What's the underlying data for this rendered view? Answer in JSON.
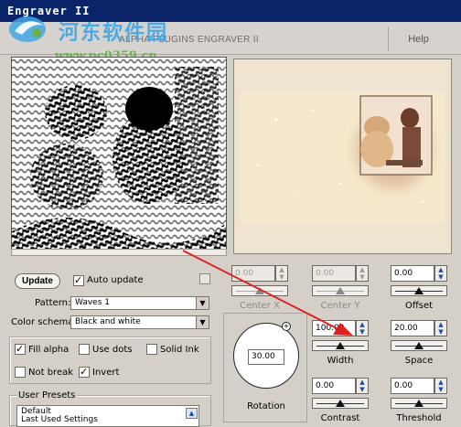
{
  "window": {
    "title": "Engraver II"
  },
  "watermark": {
    "cn": "河东软件园",
    "url": "www.pc0359.cn"
  },
  "header": {
    "brand": "ALPHA PLUGINS ENGRAVER II",
    "help": "Help"
  },
  "controls": {
    "update_label": "Update",
    "auto_update": {
      "label": "Auto update",
      "checked": true
    },
    "pattern": {
      "label": "Pattern:",
      "value": "Waves 1"
    },
    "color_schema": {
      "label": "Color schema:",
      "value": "Black and white"
    },
    "fill_alpha": {
      "label": "Fill alpha",
      "checked": true
    },
    "use_dots": {
      "label": "Use dots",
      "checked": false
    },
    "solid_ink": {
      "label": "Solid Ink",
      "checked": false
    },
    "not_break": {
      "label": "Not break",
      "checked": false
    },
    "invert": {
      "label": "Invert",
      "checked": true
    }
  },
  "presets": {
    "title": "User Presets",
    "items": [
      "Default",
      "Last Used Settings"
    ]
  },
  "params": {
    "center_x": {
      "label": "Center X",
      "value": "0.00",
      "enabled": false
    },
    "center_y": {
      "label": "Center Y",
      "value": "0.00",
      "enabled": false
    },
    "offset": {
      "label": "Offset",
      "value": "0.00",
      "enabled": true
    },
    "width": {
      "label": "Width",
      "value": "100.00",
      "enabled": true
    },
    "space": {
      "label": "Space",
      "value": "20.00",
      "enabled": true
    },
    "contrast": {
      "label": "Contrast",
      "value": "0.00",
      "enabled": true
    },
    "threshold": {
      "label": "Threshold",
      "value": "0.00",
      "enabled": true
    },
    "rotation": {
      "label": "Rotation",
      "value": "30.00"
    }
  },
  "colors": {
    "titlebar": "#0a246a",
    "annotation_arrow": "#e02020",
    "preview_bg": "#efe4cf"
  }
}
